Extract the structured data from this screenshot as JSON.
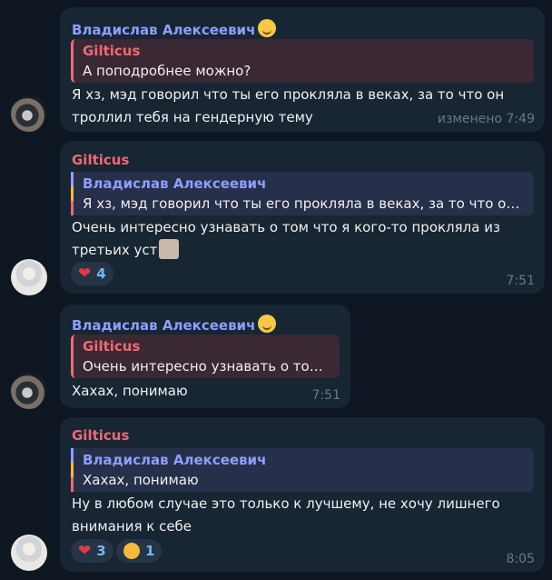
{
  "messages": [
    {
      "sender": "Владислав Алексеевич",
      "reply_name": "Gilticus",
      "reply_text": "А поподробнее можно?",
      "text_lines": [
        "Я хз, мэд говорил что ты его прокляла в веках, за то что он",
        "троллил тебя на гендерную тему"
      ],
      "time": "изменено 7:49"
    },
    {
      "sender": "Gilticus",
      "reply_name": "Владислав Алексеевич",
      "reply_text": "Я хз, мэд говорил что ты его прокляла в веках, за то что он т…",
      "text_lines": [
        "Очень интересно узнавать о том что я кого-то прокляла из",
        "третьих уст"
      ],
      "reactions": [
        {
          "emoji": "heart",
          "count": "4"
        }
      ],
      "time": "7:51"
    },
    {
      "sender": "Владислав Алексеевич",
      "reply_name": "Gilticus",
      "reply_text": "Очень интересно узнавать о том …",
      "text_lines": [
        "Хахах, понимаю"
      ],
      "time": "7:51"
    },
    {
      "sender": "Gilticus",
      "reply_name": "Владислав Алексеевич",
      "reply_text": "Хахах, понимаю",
      "text_lines": [
        "Ну в любом случае это только к лучшему, не хочу лишнего",
        "внимания к себе"
      ],
      "reactions": [
        {
          "emoji": "heart",
          "count": "3"
        },
        {
          "emoji": "smiling-face-with-hearts",
          "count": "1"
        }
      ],
      "time": "8:05"
    }
  ]
}
